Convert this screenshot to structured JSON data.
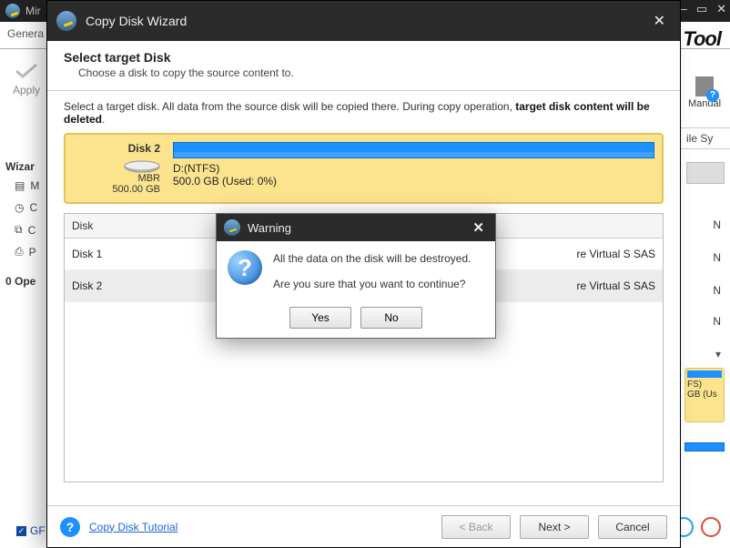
{
  "bg": {
    "app_title_short": "Mir",
    "tab_general": "Genera",
    "apply": "Apply",
    "wizards_label": "Wizar",
    "side_items": [
      "M",
      "C",
      "C",
      "P"
    ],
    "operations": "0 Ope",
    "manual": "Manual",
    "file_sys": "ile Sy",
    "logo": "Tool",
    "right_n": "N",
    "mini_fs": "FS)",
    "mini_gb": "GB (Us",
    "bottom_check": "GF"
  },
  "wizard": {
    "title": "Copy Disk Wizard",
    "header_title": "Select target Disk",
    "header_sub": "Choose a disk to copy the source content to.",
    "instr_prefix": "Select a target disk. All data from the source disk will be copied there. During copy operation, ",
    "instr_bold": "target disk content will be deleted",
    "selected_disk": {
      "name": "Disk 2",
      "mbr": "MBR",
      "size": "500.00 GB",
      "part_label": "D:(NTFS)",
      "part_usage": "500.0 GB (Used: 0%)"
    },
    "table": {
      "col1": "Disk",
      "rows": [
        {
          "name": "Disk 1",
          "info": "re Virtual S SAS"
        },
        {
          "name": "Disk 2",
          "info": "re Virtual S SAS"
        }
      ]
    },
    "tutorial": "Copy Disk Tutorial",
    "btn_back": "< Back",
    "btn_next": "Next >",
    "btn_cancel": "Cancel"
  },
  "warning": {
    "title": "Warning",
    "line1": "All the data on the disk will be destroyed.",
    "line2": "Are you sure that you want to continue?",
    "yes": "Yes",
    "no": "No"
  }
}
